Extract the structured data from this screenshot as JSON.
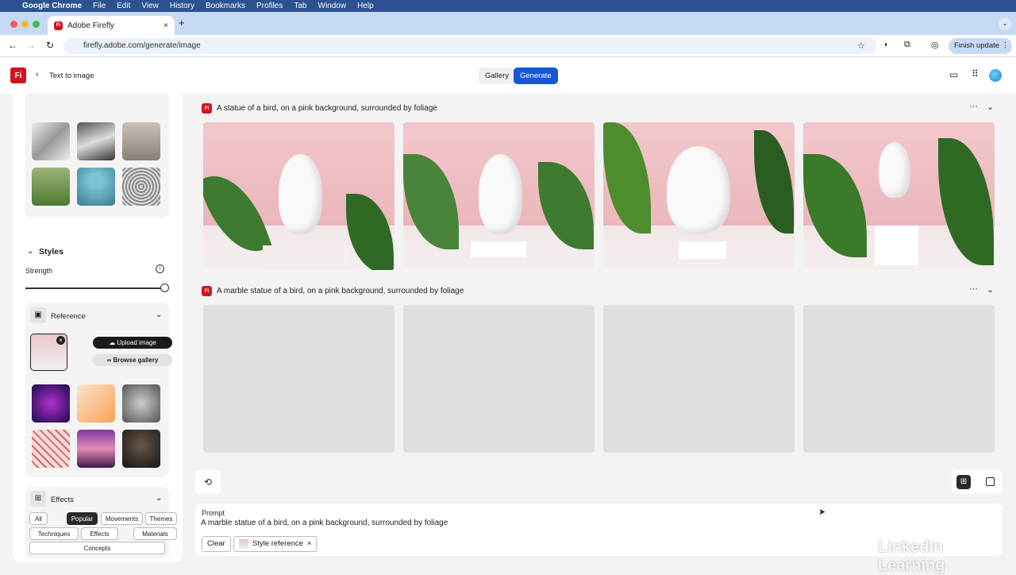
{
  "menubar": {
    "apple": "",
    "items": [
      "Google Chrome",
      "File",
      "Edit",
      "View",
      "History",
      "Bookmarks",
      "Profiles",
      "Tab",
      "Window",
      "Help"
    ]
  },
  "browser": {
    "tab_title": "Adobe Firefly",
    "url": "firefly.adobe.com/generate/image",
    "finish_update": "Finish update"
  },
  "app": {
    "logo": "Fi",
    "back_label": "Text to image",
    "gallery": "Gallery",
    "generate": "Generate"
  },
  "sidebar": {
    "styles_title": "Styles",
    "strength_label": "Strength",
    "strength_value": 1.0,
    "reference_title": "Reference",
    "upload_image": "Upload image",
    "browse_gallery": "Browse gallery",
    "effects_title": "Effects",
    "effect_filters": [
      "All",
      "Popular",
      "Movements",
      "Themes",
      "Techniques",
      "Effects",
      "Materials",
      "Concepts"
    ],
    "active_filter": "Popular"
  },
  "results": [
    {
      "prompt": "A statue of a bird, on a pink background, surrounded by foliage"
    },
    {
      "prompt": "A marble statue of a bird, on a pink background, surrounded by foliage"
    }
  ],
  "prompt": {
    "label": "Prompt",
    "value": "A marble statue of a bird, on a pink background, surrounded by foliage",
    "clear": "Clear",
    "style_reference": "Style reference"
  },
  "watermark": "LinkedIn Learning"
}
